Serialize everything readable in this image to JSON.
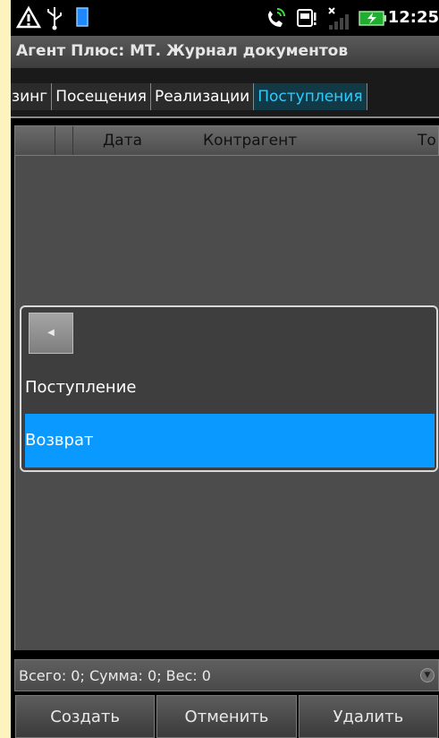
{
  "status_bar": {
    "time": "12:25",
    "icons": [
      "warning-triangle-icon",
      "usb-icon",
      "battery-small-icon",
      "phone-call-icon",
      "sd-card-icon",
      "signal-icon",
      "battery-charging-icon"
    ]
  },
  "app": {
    "title": "Агент Плюс: МТ. Журнал документов"
  },
  "tabs": [
    {
      "label": "йзинг",
      "active": false
    },
    {
      "label": "Посещения",
      "active": false
    },
    {
      "label": "Реализации",
      "active": false
    },
    {
      "label": "Поступления",
      "active": true
    }
  ],
  "table": {
    "columns": [
      "Дата",
      "Контрагент",
      "То"
    ]
  },
  "popup": {
    "items": [
      {
        "label": "Поступление",
        "selected": false
      },
      {
        "label": "Возврат",
        "selected": true
      }
    ]
  },
  "summary": {
    "text": "Всего: 0; Сумма: 0; Вес: 0"
  },
  "actions": {
    "create": "Создать",
    "cancel": "Отменить",
    "delete": "Удалить"
  },
  "colors": {
    "accent": "#0a99ff",
    "active_tab_text": "#2ecbff",
    "page_background": "#fdf3bf"
  }
}
